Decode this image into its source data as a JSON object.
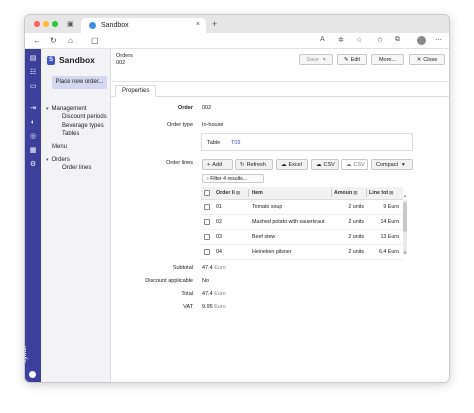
{
  "browser": {
    "tab_title": "Sandbox",
    "tab_close": "×",
    "new_tab": "+"
  },
  "app": {
    "name": "Sandbox",
    "logo_letter": "S",
    "vendor": "kymer"
  },
  "sidebar": {
    "primary_action": "Place new order...",
    "groups": [
      {
        "label": "Management",
        "items": [
          "Discount periods",
          "Beverage types",
          "Tables"
        ]
      },
      {
        "label": "Menu",
        "items": []
      },
      {
        "label": "Orders",
        "items": [
          "Order lines"
        ]
      }
    ]
  },
  "header": {
    "breadcrumb": "Orders",
    "record_id": "002",
    "buttons": {
      "save": "Save",
      "edit": "Edit",
      "more": "More...",
      "close": "Close"
    }
  },
  "tabs": [
    "Properties"
  ],
  "form": {
    "order_label": "Order",
    "order_value": "002",
    "order_type_label": "Order type",
    "order_type_value": "In-house",
    "table_label": "Table",
    "table_value": "T03",
    "order_lines_label": "Order lines"
  },
  "order_lines": {
    "toolbar": {
      "add": "Add",
      "refresh": "Refresh",
      "excel": "Excel",
      "csv": "CSV",
      "csv2": "CSV",
      "compact": "Compact"
    },
    "filter_text": "Filter 4 results...",
    "columns": [
      "Order li",
      "Item",
      "Amoun",
      "Line tot"
    ],
    "rows": [
      {
        "order": "01",
        "item": "Tomato soup",
        "amount": "2 units",
        "total": "9 Euro"
      },
      {
        "order": "02",
        "item": "Mashed potato with sauerkraut",
        "amount": "2 units",
        "total": "14 Euro"
      },
      {
        "order": "03",
        "item": "Beef stew",
        "amount": "2 units",
        "total": "13 Euro"
      },
      {
        "order": "04",
        "item": "Heineken pilsner",
        "amount": "2 units",
        "total": "6,4 Euro"
      }
    ]
  },
  "totals": {
    "subtotal_label": "Subtotal",
    "subtotal_value": "47.4",
    "subtotal_unit": "Euro",
    "discount_label": "Discount applicable",
    "discount_value": "No",
    "total_label": "Total",
    "total_value": "47.4",
    "total_unit": "Euro",
    "vat_label": "VAT",
    "vat_value": "9.95",
    "vat_unit": "Euro"
  },
  "colors": {
    "leftbar": "#3c3f9c",
    "accent": "#3d55c7",
    "link": "#3a4fd0",
    "primary_button": "#d5d7ef"
  }
}
